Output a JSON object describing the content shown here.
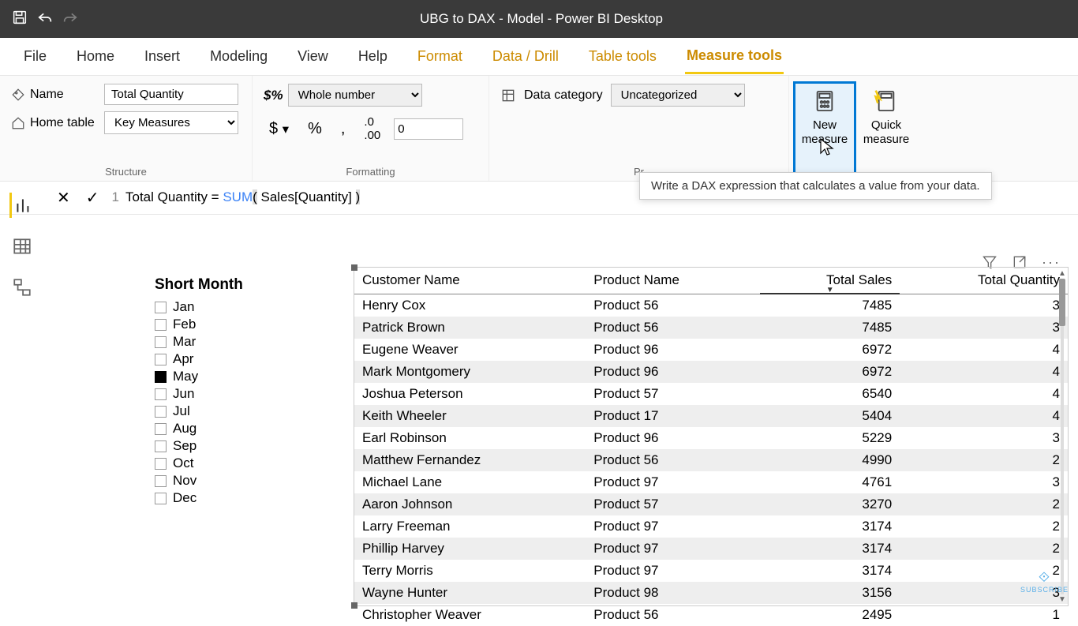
{
  "titlebar": {
    "title": "UBG to DAX - Model - Power BI Desktop"
  },
  "tabs": {
    "file": "File",
    "home": "Home",
    "insert": "Insert",
    "modeling": "Modeling",
    "view": "View",
    "help": "Help",
    "format": "Format",
    "datadrill": "Data / Drill",
    "tabletools": "Table tools",
    "measuretools": "Measure tools"
  },
  "ribbon": {
    "structure": {
      "name_label": "Name",
      "name_value": "Total Quantity",
      "home_label": "Home table",
      "home_value": "Key Measures",
      "group": "Structure"
    },
    "formatting": {
      "format_value": "Whole number",
      "decimals": "0",
      "group": "Formatting"
    },
    "properties": {
      "datacat_label": "Data category",
      "datacat_value": "Uncategorized",
      "group": "Properties"
    },
    "calculations": {
      "new_measure_l1": "New",
      "new_measure_l2": "measure",
      "quick_measure_l1": "Quick",
      "quick_measure_l2": "measure"
    }
  },
  "tooltip": "Write a DAX expression that calculates a value from your data.",
  "formula": {
    "line": "1",
    "text_pre": "Total Quantity = ",
    "fn": "SUM",
    "open": "(",
    "arg": " Sales[Quantity] ",
    "close": ")"
  },
  "slicer": {
    "title": "Short Month",
    "items": [
      {
        "label": "Jan",
        "checked": false
      },
      {
        "label": "Feb",
        "checked": false
      },
      {
        "label": "Mar",
        "checked": false
      },
      {
        "label": "Apr",
        "checked": false
      },
      {
        "label": "May",
        "checked": true
      },
      {
        "label": "Jun",
        "checked": false
      },
      {
        "label": "Jul",
        "checked": false
      },
      {
        "label": "Aug",
        "checked": false
      },
      {
        "label": "Sep",
        "checked": false
      },
      {
        "label": "Oct",
        "checked": false
      },
      {
        "label": "Nov",
        "checked": false
      },
      {
        "label": "Dec",
        "checked": false
      }
    ]
  },
  "table": {
    "headers": [
      "Customer Name",
      "Product Name",
      "Total Sales",
      "Total Quantity"
    ],
    "rows": [
      [
        "Henry Cox",
        "Product 56",
        "7485",
        "3"
      ],
      [
        "Patrick Brown",
        "Product 56",
        "7485",
        "3"
      ],
      [
        "Eugene Weaver",
        "Product 96",
        "6972",
        "4"
      ],
      [
        "Mark Montgomery",
        "Product 96",
        "6972",
        "4"
      ],
      [
        "Joshua Peterson",
        "Product 57",
        "6540",
        "4"
      ],
      [
        "Keith Wheeler",
        "Product 17",
        "5404",
        "4"
      ],
      [
        "Earl Robinson",
        "Product 96",
        "5229",
        "3"
      ],
      [
        "Matthew Fernandez",
        "Product 56",
        "4990",
        "2"
      ],
      [
        "Michael Lane",
        "Product 97",
        "4761",
        "3"
      ],
      [
        "Aaron Johnson",
        "Product 57",
        "3270",
        "2"
      ],
      [
        "Larry Freeman",
        "Product 97",
        "3174",
        "2"
      ],
      [
        "Phillip Harvey",
        "Product 97",
        "3174",
        "2"
      ],
      [
        "Terry Morris",
        "Product 97",
        "3174",
        "2"
      ],
      [
        "Wayne Hunter",
        "Product 98",
        "3156",
        "3"
      ],
      [
        "Christopher Weaver",
        "Product 56",
        "2495",
        "1"
      ]
    ]
  },
  "watermark": "SUBSCRIBE"
}
